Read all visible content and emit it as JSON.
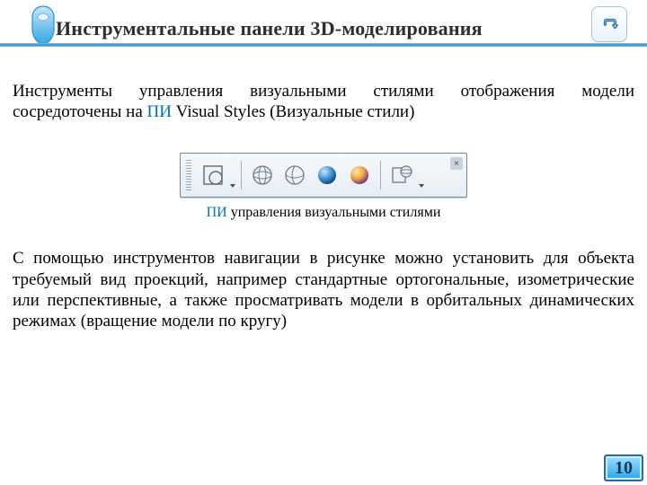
{
  "header": {
    "title": "Инструментальные панели 3D-моделирования"
  },
  "nav": {
    "back_label": "back"
  },
  "content": {
    "para1_a": "Инструменты управления визуальными стилями отображения модели сосредоточены на ",
    "para1_pi": "ПИ",
    "para1_b": " Visual Styles (Визуальные стили)",
    "caption_pi": "ПИ",
    "caption_rest": " управления визуальными стилями",
    "para2": "С помощью инструментов навигации в рисунке можно установить для объекта требуемый вид проекций, например стандартные ортогональные, изометрические или перспективные, а также просматривать модели в орбитальных динамических режимах (вращение модели по кругу)"
  },
  "toolbar": {
    "items": [
      {
        "name": "vs-2dwireframe-icon"
      },
      {
        "name": "vs-wireframe-icon"
      },
      {
        "name": "vs-hidden-icon"
      },
      {
        "name": "vs-realistic-blue-icon"
      },
      {
        "name": "vs-realistic-orange-icon"
      },
      {
        "name": "vs-manage-icon"
      }
    ]
  },
  "page": {
    "number": "10"
  }
}
